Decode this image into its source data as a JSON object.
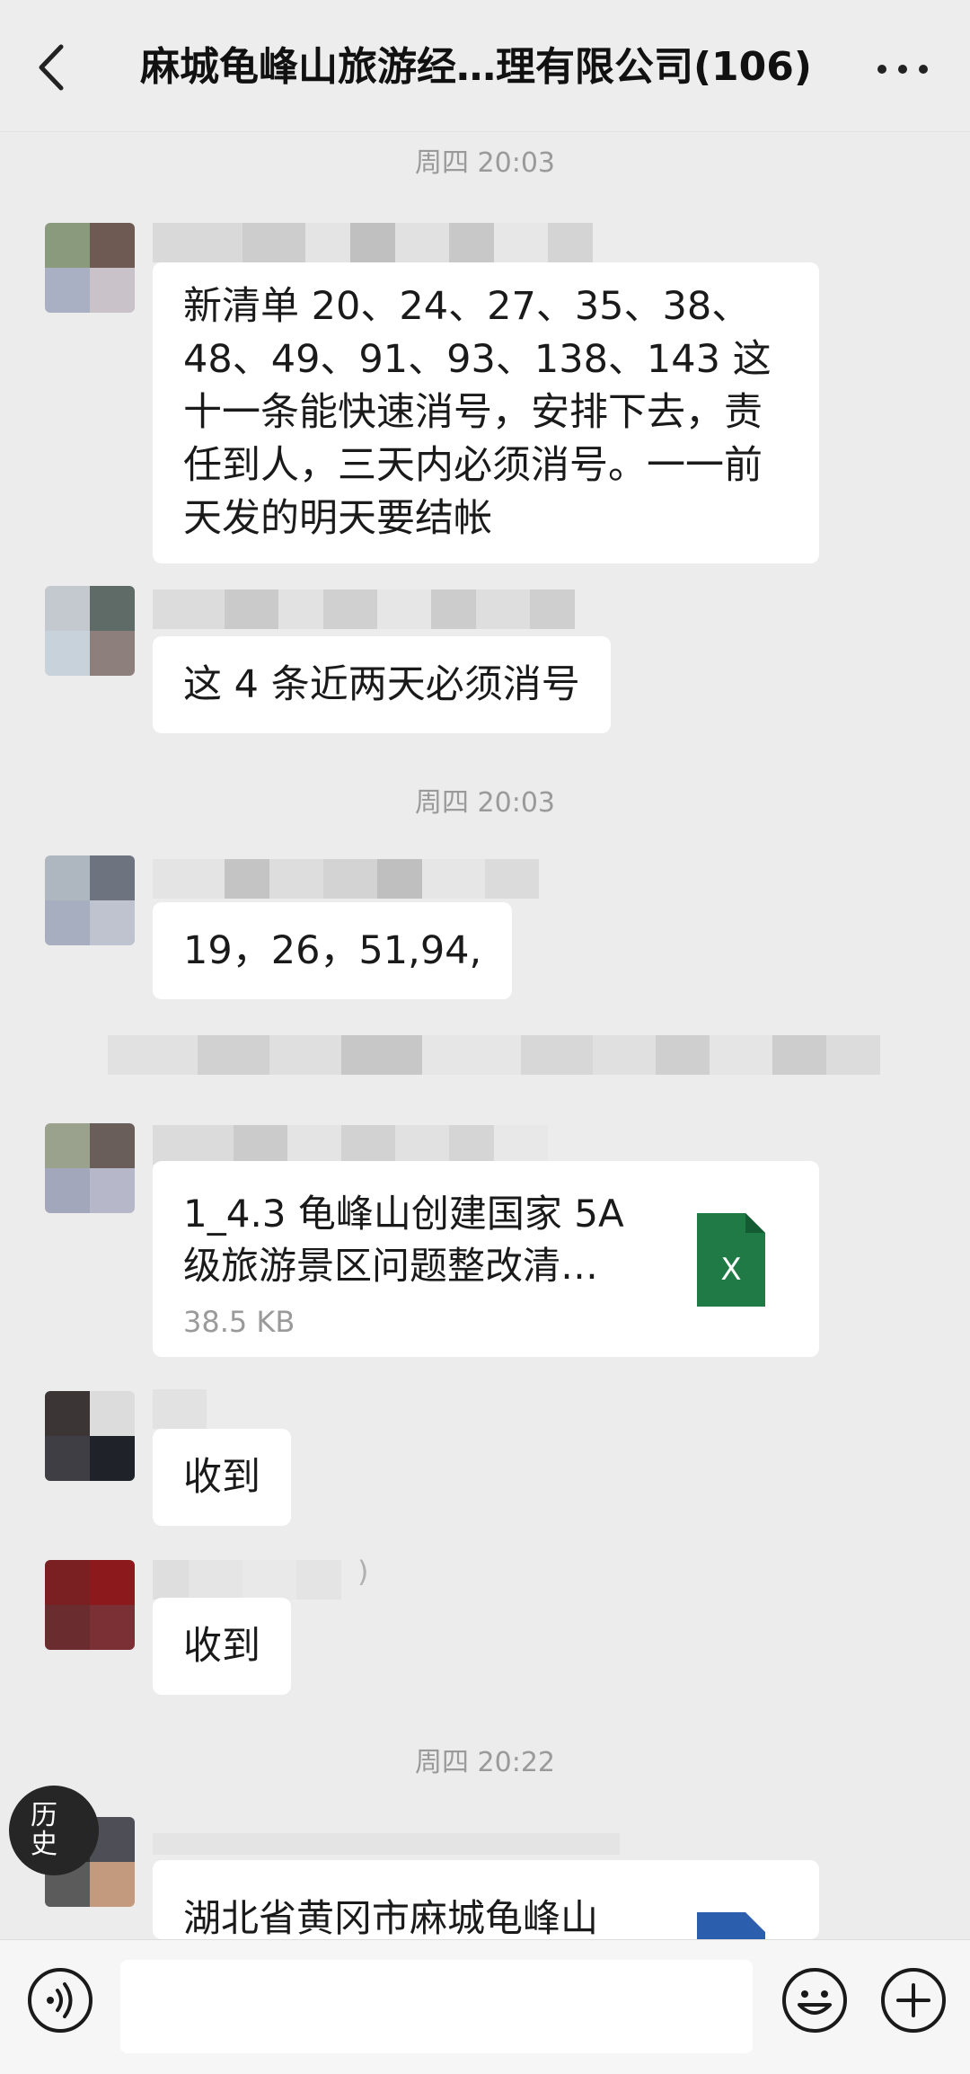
{
  "header": {
    "title": "麻城龟峰山旅游经…理有限公司(106)",
    "back_icon": "chevron-left-icon",
    "more_icon": "ellipsis-icon"
  },
  "messages": {
    "ts1": "周四 20:03",
    "msg1": [
      "新清单 20、24、27、35、38、",
      "48、49、91、93、138、143 这",
      "十一条能快速消号，安排下去，责",
      "任到人，三天内必须消号。一一前",
      "天发的明天要结帐"
    ],
    "msg2": "这 4 条近两天必须消号",
    "ts2": "周四 20:03",
    "msg3": "19，26，51,94,",
    "file1": {
      "name_line1": "1_4.3 龟峰山创建国家 5A",
      "name_line2": "级旅游景区问题整改清…",
      "size": "38.5 KB",
      "icon_letter": "X",
      "icon": "excel-file-icon"
    },
    "msg4": "收到",
    "msg5": "收到",
    "msg5_sender_suffix": ")",
    "ts3": "周四 20:22",
    "msg6": "湖北省黄冈市麻城龟峰山"
  },
  "history_button": {
    "line1": "历",
    "line2": "史"
  },
  "composer": {
    "voice_icon": "voice-icon",
    "emoji_icon": "emoji-icon",
    "plus_icon": "plus-circle-icon",
    "placeholder": ""
  },
  "colors": {
    "background": "#ececec",
    "bubble": "#ffffff",
    "excel_green": "#1f7a45",
    "word_blue": "#2b5fad"
  }
}
